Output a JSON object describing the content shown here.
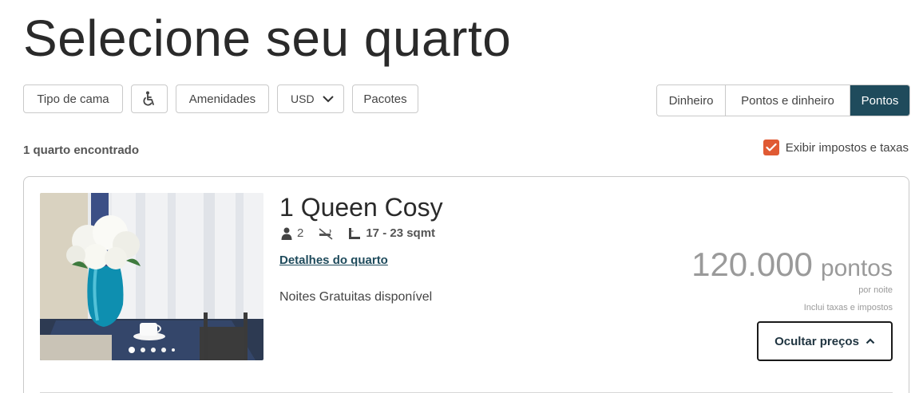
{
  "page_title": "Selecione seu quarto",
  "filters": {
    "bed_type": "Tipo de cama",
    "accessibility_icon": "wheelchair-icon",
    "amenities": "Amenidades",
    "currency": "USD",
    "packages": "Pacotes"
  },
  "rate_toggle": {
    "options": [
      "Dinheiro",
      "Pontos e dinheiro",
      "Pontos"
    ],
    "selected": "Pontos"
  },
  "results_count": "1 quarto encontrado",
  "taxes_checkbox": {
    "label": "Exibir impostos e taxas",
    "checked": true
  },
  "room": {
    "name": "1 Queen Cosy",
    "guests": "2",
    "size": "17 - 23 sqmt",
    "details_link": "Detalhes do quarto",
    "offer": "Noites Gratuitas disponível",
    "price_value": "120.000",
    "price_unit": "pontos",
    "per_night": "por noite",
    "includes": "Inclui taxas e impostos",
    "hide_prices_label": "Ocultar preços",
    "carousel_total": 5,
    "carousel_active": 1
  },
  "colors": {
    "primary": "#1f4b5c",
    "checkbox": "#e05a33",
    "price_text": "#9a9a9a"
  }
}
